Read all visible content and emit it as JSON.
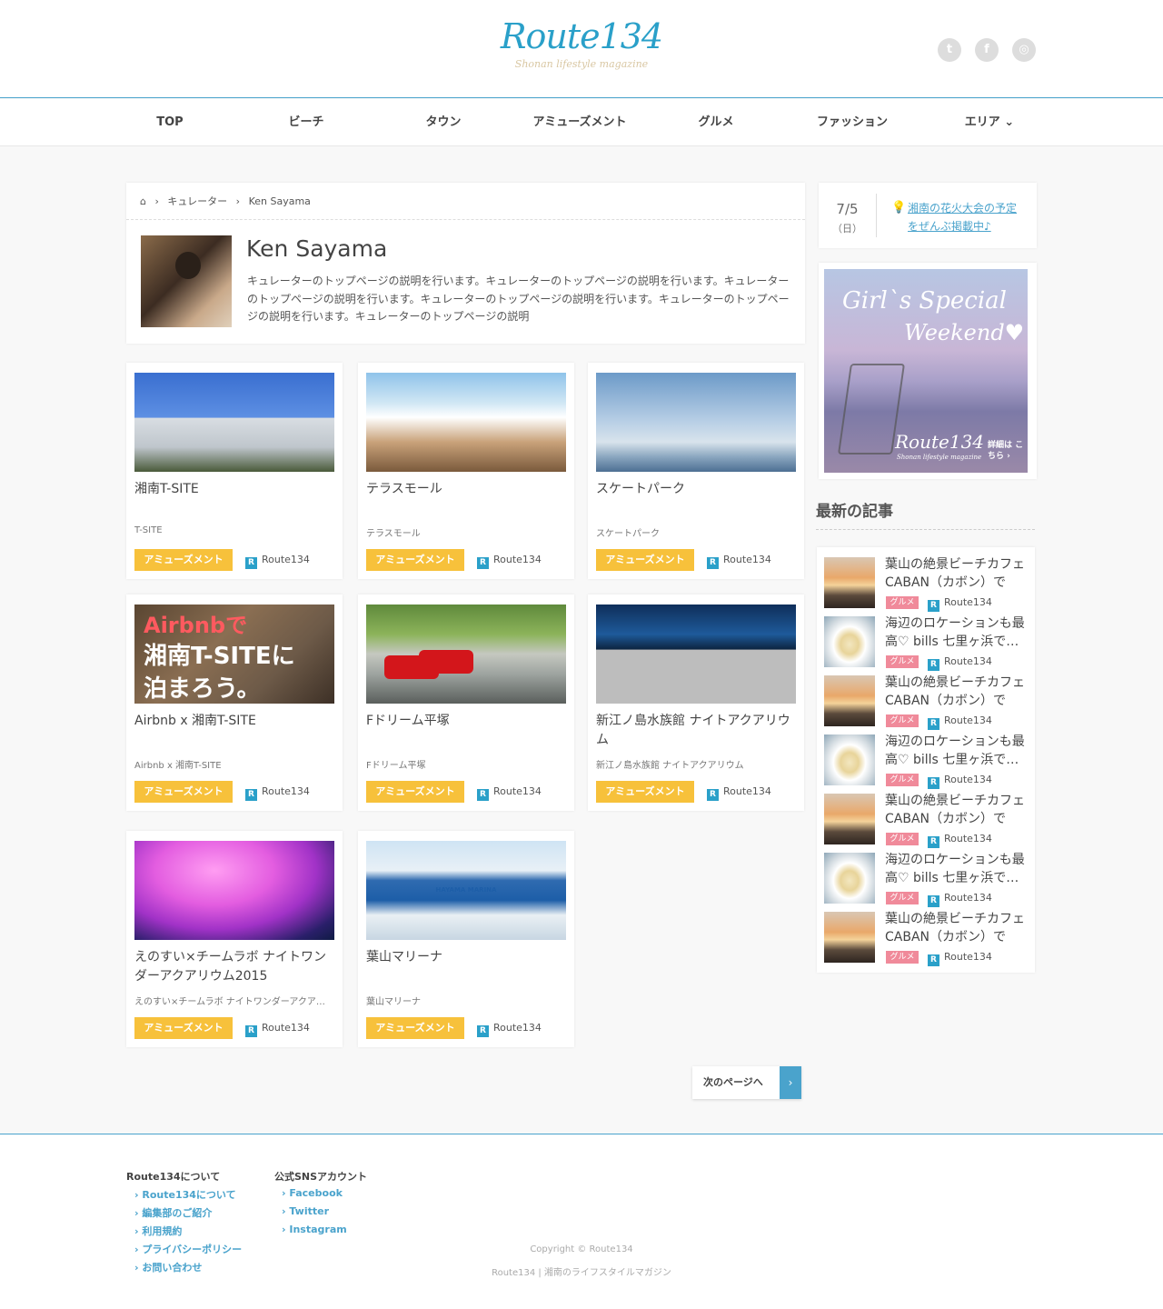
{
  "header": {
    "logo": "Route134",
    "logo_sub": "Shonan lifestyle magazine",
    "social": [
      {
        "name": "twitter-icon",
        "glyph": "t"
      },
      {
        "name": "facebook-icon",
        "glyph": "f"
      },
      {
        "name": "instagram-icon",
        "glyph": "◎"
      }
    ]
  },
  "nav": {
    "items": [
      "TOP",
      "ビーチ",
      "タウン",
      "アミューズメント",
      "グルメ",
      "ファッション",
      "エリア ⌄"
    ]
  },
  "breadcrumb": {
    "home_icon": "home-icon",
    "items": [
      "キュレーター",
      "Ken Sayama"
    ]
  },
  "profile": {
    "name": "Ken Sayama",
    "description": "キュレーターのトップページの説明を行います。キュレーターのトップページの説明を行います。キュレーターのトップページの説明を行います。キュレーターのトップページの説明を行います。キュレーターのトップページの説明を行います。キュレーターのトップページの説明"
  },
  "cards": [
    {
      "title": "湘南T-SITE",
      "sub": "T-SITE",
      "tag": "アミューズメント",
      "source": "Route134"
    },
    {
      "title": "テラスモール",
      "sub": "テラスモール",
      "tag": "アミューズメント",
      "source": "Route134"
    },
    {
      "title": "スケートパーク",
      "sub": "スケートパーク",
      "tag": "アミューズメント",
      "source": "Route134"
    },
    {
      "title": "Airbnb x 湘南T-SITE",
      "sub": "Airbnb x 湘南T-SITE",
      "tag": "アミューズメント",
      "source": "Route134",
      "img_text_1": "Airbnbで",
      "img_text_2": "湘南T-SITEに",
      "img_text_3": "泊まろう。"
    },
    {
      "title": "Fドリーム平塚",
      "sub": "Fドリーム平塚",
      "tag": "アミューズメント",
      "source": "Route134"
    },
    {
      "title": "新江ノ島水族館 ナイトアクアリウム",
      "sub": "新江ノ島水族館 ナイトアクアリウム",
      "tag": "アミューズメント",
      "source": "Route134"
    },
    {
      "title": "えのすい×チームラボ ナイトワンダーアクアリウム2015",
      "sub": "えのすい×チームラボ ナイトワンダーアクア…",
      "tag": "アミューズメント",
      "source": "Route134"
    },
    {
      "title": "葉山マリーナ",
      "sub": "葉山マリーナ",
      "tag": "アミューズメント",
      "source": "Route134",
      "img_text_1": "HAYAMA MARINA"
    }
  ],
  "pager": {
    "label": "次のページへ",
    "arrow": "›"
  },
  "sidebar": {
    "event": {
      "date": "7/5",
      "day": "（日）",
      "link": "湘南の花火大会の予定をぜんぶ掲載中♪"
    },
    "banner": {
      "line1": "Girl`s Special",
      "line2": "Weekend♥",
      "logo": "Route134",
      "logo_sub": "Shonan lifestyle magazine",
      "cta": "詳細は こちら ›"
    },
    "latest_title": "最新の記事",
    "latest": [
      {
        "text": "葉山の絶景ビーチカフェ CABAN（カボン）でリ…",
        "tag": "グルメ",
        "source": "Route134",
        "thumb": "sunset"
      },
      {
        "text": "海辺のロケーションも最高♡ bills 七里ヶ浜で…",
        "tag": "グルメ",
        "source": "Route134",
        "thumb": "cake"
      },
      {
        "text": "葉山の絶景ビーチカフェ CABAN（カボン）でリ…",
        "tag": "グルメ",
        "source": "Route134",
        "thumb": "sunset"
      },
      {
        "text": "海辺のロケーションも最高♡ bills 七里ヶ浜で…",
        "tag": "グルメ",
        "source": "Route134",
        "thumb": "cake"
      },
      {
        "text": "葉山の絶景ビーチカフェ CABAN（カボン）でリ…",
        "tag": "グルメ",
        "source": "Route134",
        "thumb": "sunset"
      },
      {
        "text": "海辺のロケーションも最高♡ bills 七里ヶ浜で…",
        "tag": "グルメ",
        "source": "Route134",
        "thumb": "cake"
      },
      {
        "text": "葉山の絶景ビーチカフェ CABAN（カボン）でリ…",
        "tag": "グルメ",
        "source": "Route134",
        "thumb": "sunset"
      }
    ]
  },
  "footer": {
    "col1_title": "Route134について",
    "col1_links": [
      "› Route134について",
      "› 編集部のご紹介",
      "› 利用規約",
      "› プライバシーポリシー",
      "› お問い合わせ"
    ],
    "col2_title": "公式SNSアカウント",
    "col2_links": [
      "› Facebook",
      "› Twitter",
      "› Instagram"
    ],
    "copyright": "Copyright © Route134",
    "tagline": "Route134 | 湘南のライフスタイルマガジン"
  },
  "colors": {
    "accent": "#2aa0c9",
    "tag": "#f7c13b",
    "gourmet": "#f08a9a"
  }
}
